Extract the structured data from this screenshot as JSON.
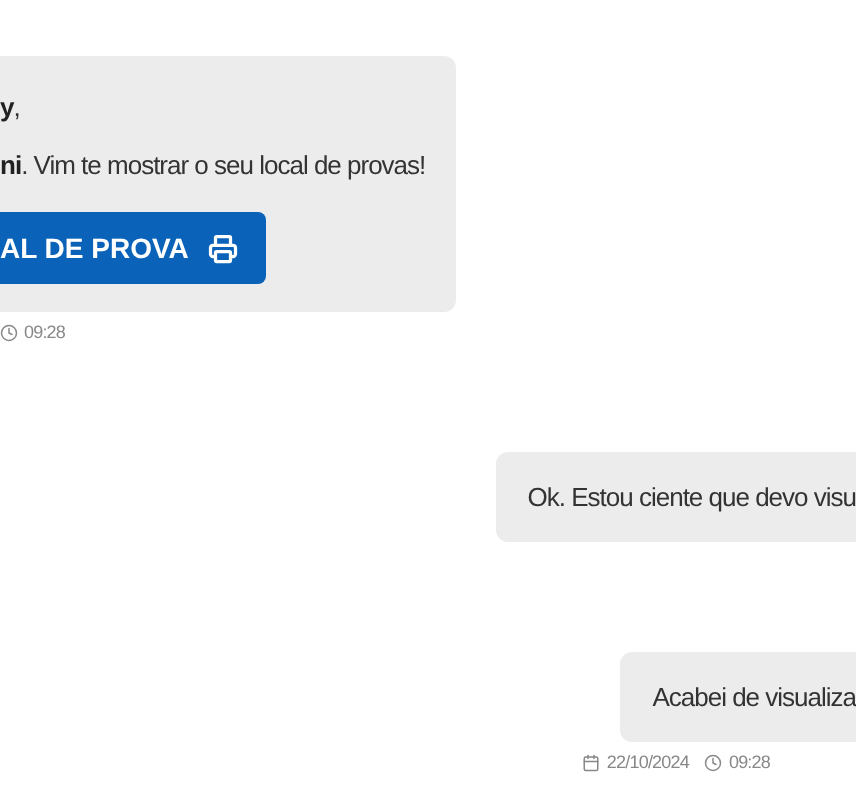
{
  "messages": [
    {
      "kind": "incoming",
      "lines": [
        "**y**,",
        "**ni**. Vim te mostrar o seu local de provas!"
      ],
      "button": "AL DE PROVA",
      "time": "09:28"
    },
    {
      "kind": "outgoing",
      "lines": [
        "Ok. Estou ciente que devo visu"
      ]
    },
    {
      "kind": "outgoing",
      "lines": [
        "Acabei de visualiza"
      ],
      "date": "22/10/2024",
      "time": "09:28"
    }
  ]
}
